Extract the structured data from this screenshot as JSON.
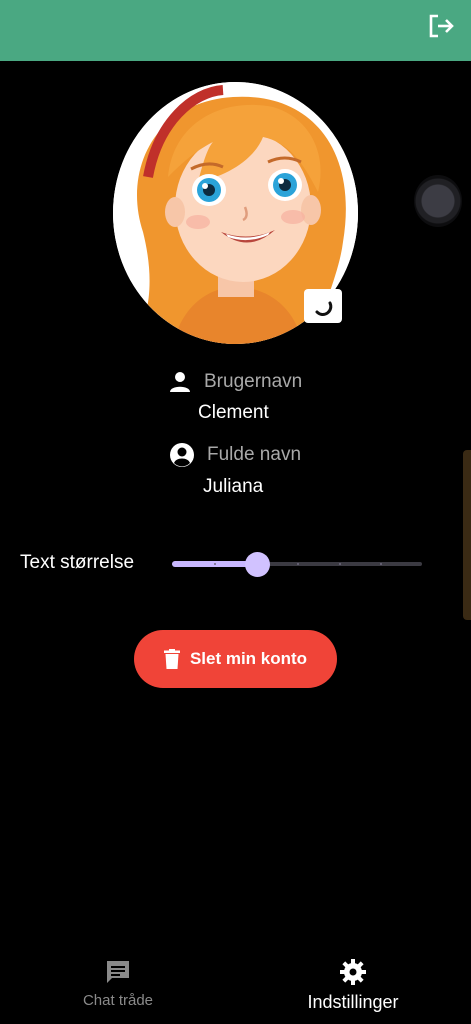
{
  "appbar": {
    "color": "#4aa882",
    "logout_icon": "logout-icon"
  },
  "profile": {
    "avatar_icon": "cartoon-girl-avatar",
    "edit_icon": "refresh-icon",
    "username_label": "Brugernavn",
    "username_value": "Clement",
    "fullname_label": "Fulde navn",
    "fullname_value": "Juliana"
  },
  "settings": {
    "text_size_label": "Text størrelse",
    "text_size_value": 0.34,
    "slider_divisions": 6
  },
  "actions": {
    "delete_label": "Slet min konto",
    "delete_color": "#f04438"
  },
  "bottom_nav": {
    "items": [
      {
        "label": "Chat tråde",
        "icon": "chat-icon",
        "active": false
      },
      {
        "label": "Indstillinger",
        "icon": "gear-icon",
        "active": true
      }
    ]
  }
}
